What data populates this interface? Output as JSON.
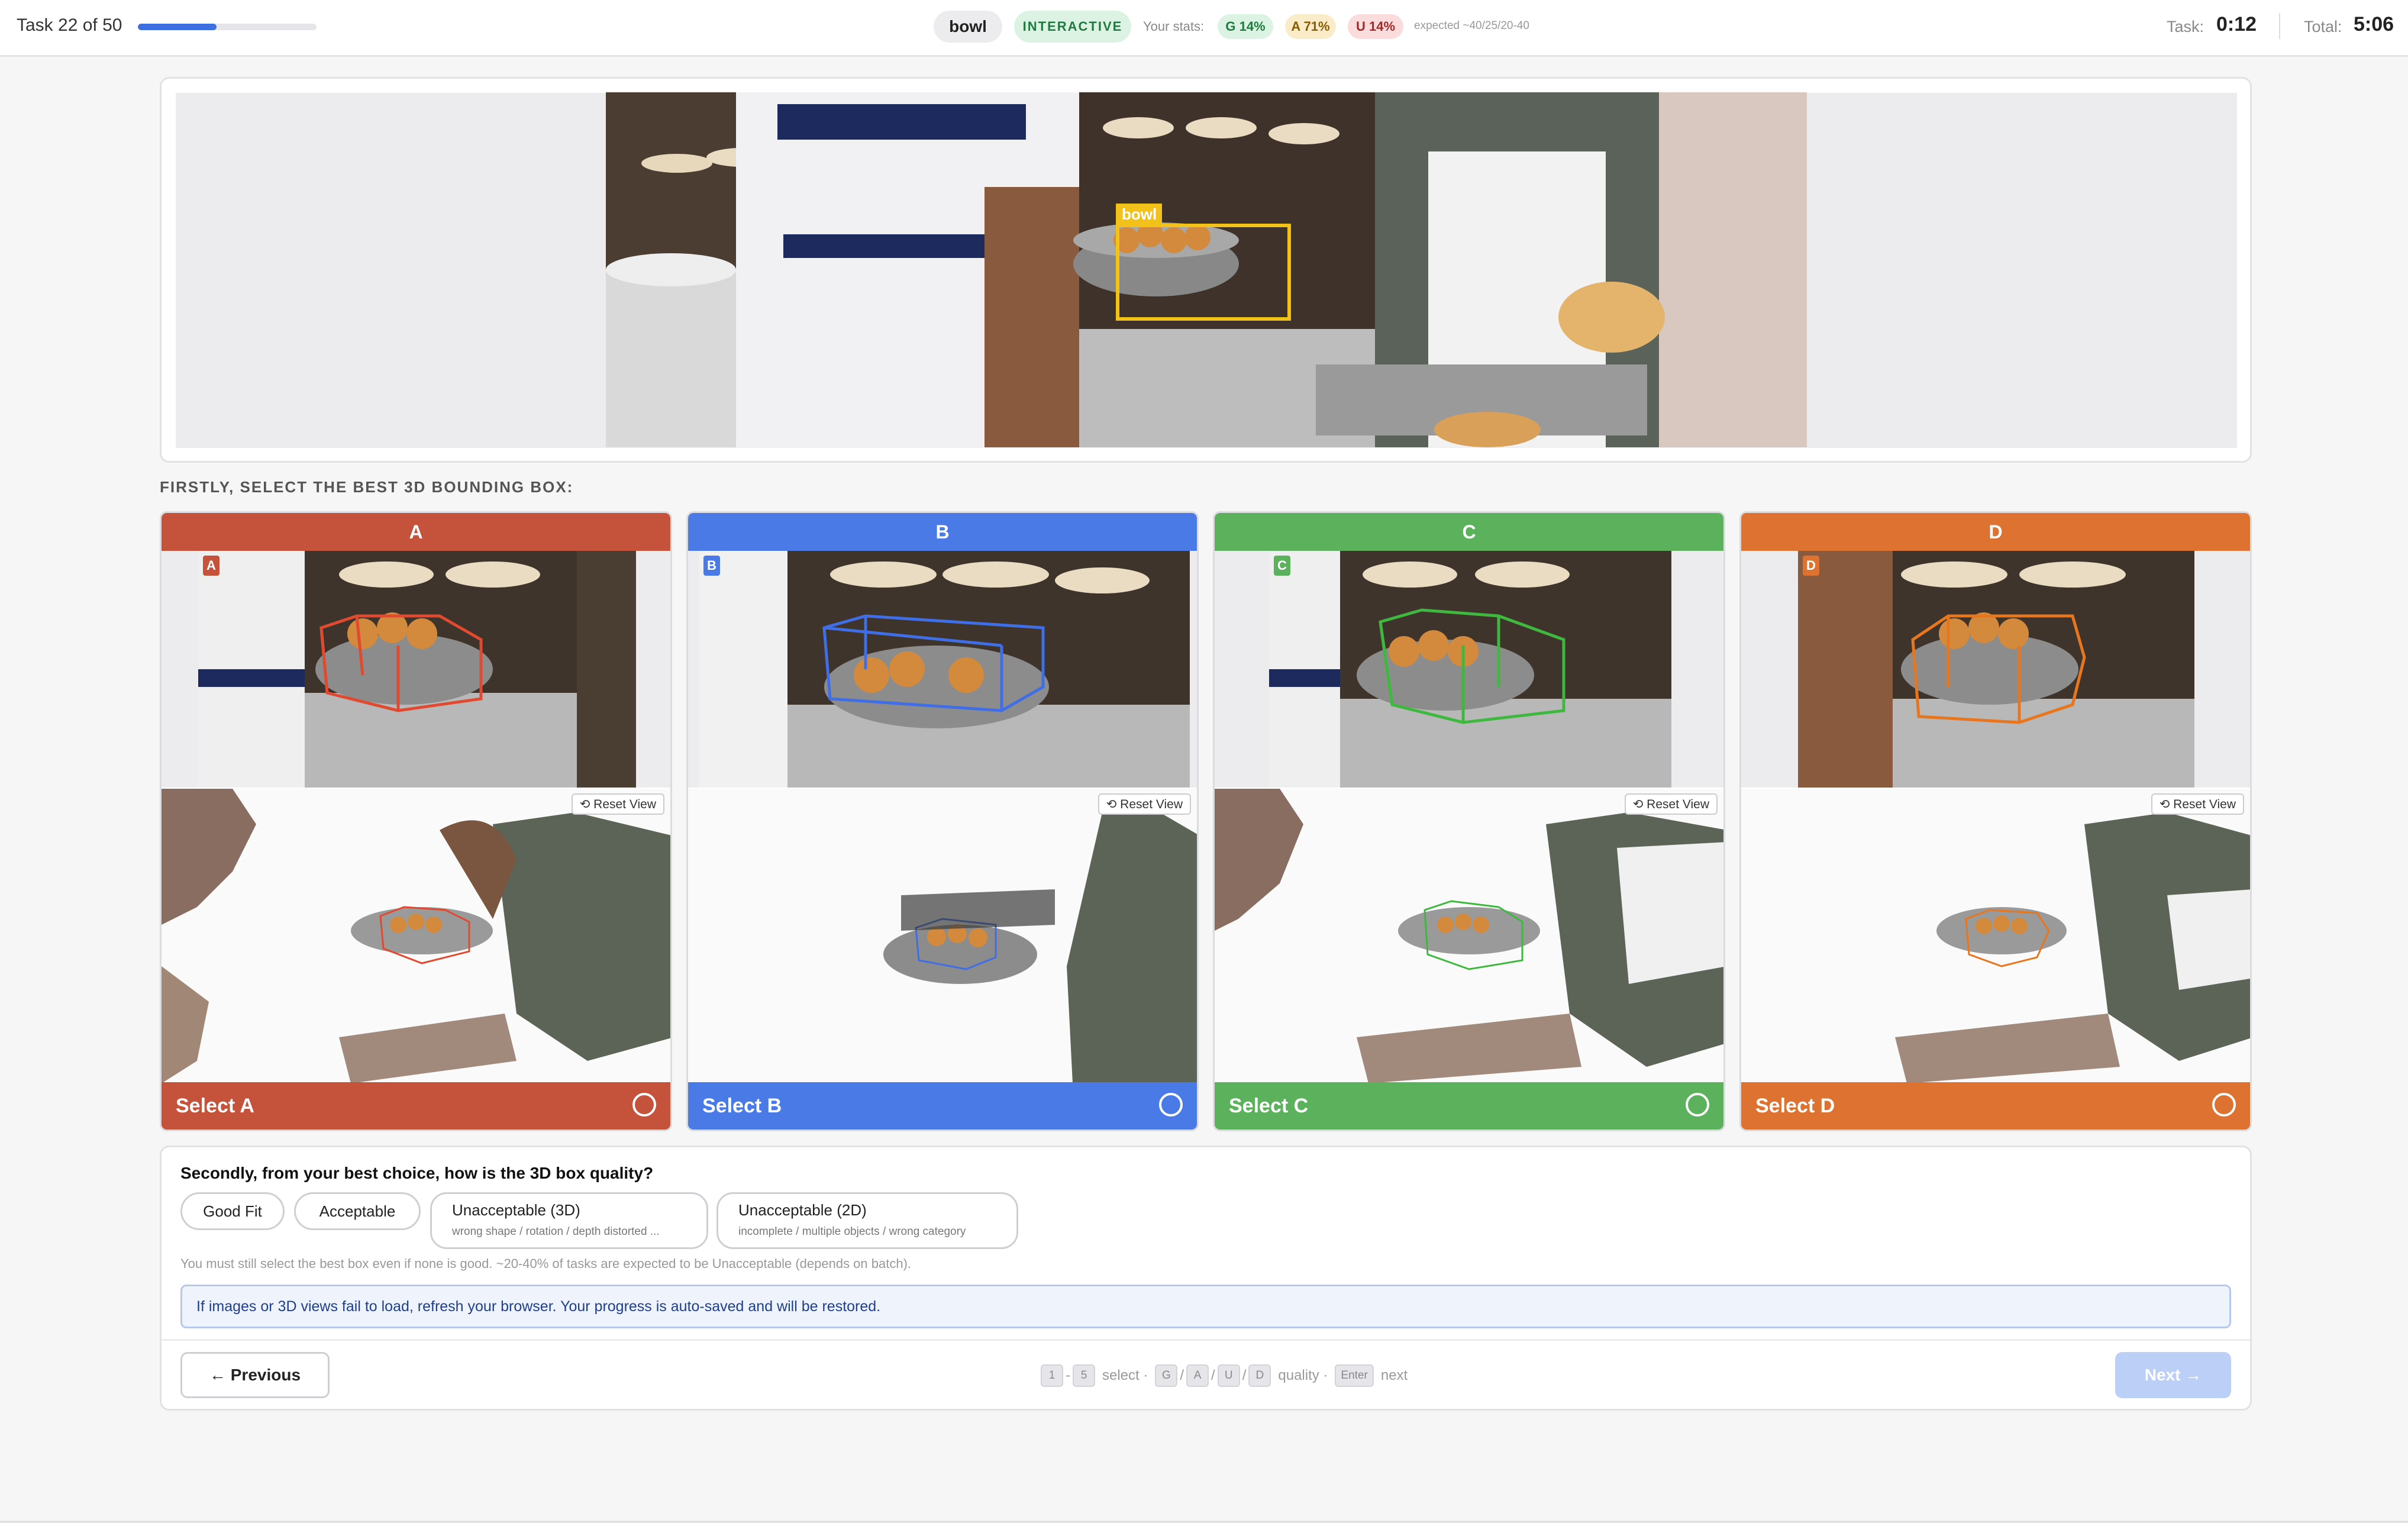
{
  "header": {
    "task_label": "Task 22 of 50",
    "progress_fraction": 0.44,
    "category": "bowl",
    "mode": "INTERACTIVE",
    "stats_label": "Your stats:",
    "stat_g": "G 14%",
    "stat_a": "A 71%",
    "stat_u": "U 14%",
    "expected": "expected ~40/25/20-40",
    "task_time_label": "Task:",
    "task_time": "0:12",
    "total_time_label": "Total:",
    "total_time": "5:06"
  },
  "main_image": {
    "box_label": "bowl"
  },
  "section_title": "FIRSTLY, SELECT THE BEST 3D BOUNDING BOX:",
  "options": [
    {
      "letter": "A",
      "select_label": "Select A",
      "color": "#c5523a",
      "reset_label": "⟲ Reset View"
    },
    {
      "letter": "B",
      "select_label": "Select B",
      "color": "#4a7ae6",
      "reset_label": "⟲ Reset View"
    },
    {
      "letter": "C",
      "select_label": "Select C",
      "color": "#5cb25c",
      "reset_label": "⟲ Reset View"
    },
    {
      "letter": "D",
      "select_label": "Select D",
      "color": "#de7231",
      "reset_label": "⟲ Reset View"
    }
  ],
  "quality": {
    "title": "Secondly, from your best choice, how is the 3D box quality?",
    "good_fit": "Good Fit",
    "acceptable": "Acceptable",
    "unacc_3d": "Unacceptable (3D)",
    "unacc_3d_sub": "wrong shape / rotation / depth distorted ...",
    "unacc_2d": "Unacceptable (2D)",
    "unacc_2d_sub": "incomplete / multiple objects / wrong category",
    "note": "You must still select the best box even if none is good. ~20-40% of tasks are expected to be Unacceptable (depends on batch).",
    "info": "If images or 3D views fail to load, refresh your browser. Your progress is auto-saved and will be restored."
  },
  "nav": {
    "previous": "← Previous",
    "next": "Next →",
    "hint_select": "select ·",
    "hint_quality": "quality ·",
    "hint_next": "next",
    "keys_1": "1",
    "keys_5": "5",
    "key_g": "G",
    "key_a": "A",
    "key_u": "U",
    "key_d": "D",
    "key_enter": "Enter"
  }
}
